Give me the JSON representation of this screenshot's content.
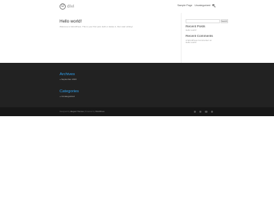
{
  "header": {
    "logo_mark": "D",
    "logo_text": "divi",
    "nav": [
      "Sample Page",
      "Uncategorized"
    ]
  },
  "post": {
    "title": "Hello world!",
    "excerpt": "Welcome to WordPress. This is your first post. Edit or delete it, then start writing!"
  },
  "sidebar": {
    "search_button": "Search",
    "recent_posts_title": "Recent Posts",
    "recent_posts": [
      "Hello world!"
    ],
    "recent_comments_title": "Recent Comments",
    "recent_comments": [
      "A WordPress Commenter on",
      "Hello world!"
    ]
  },
  "footer": {
    "archives_title": "Archives",
    "archives_item": "September 2023",
    "categories_title": "Categories",
    "categories_item": "Uncategorized",
    "credits_prefix": "Designed by",
    "credits_theme": "Elegant Themes",
    "credits_mid": "| Powered by",
    "credits_platform": "WordPress",
    "social_icons": [
      "facebook-icon",
      "twitter-icon",
      "instagram-icon",
      "rss-icon"
    ]
  },
  "colors": {
    "accent": "#2ea3f2",
    "footer_bg": "#222222",
    "bottom_bar_bg": "#171717"
  }
}
